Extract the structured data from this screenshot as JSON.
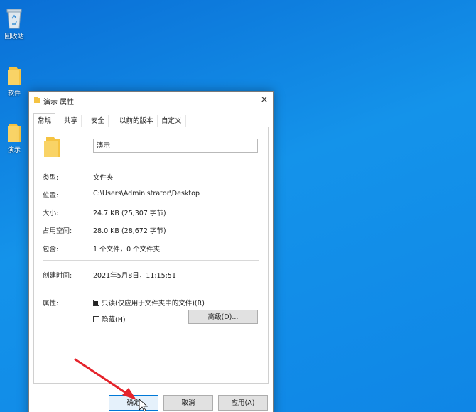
{
  "desktop": {
    "icons": [
      {
        "label": "回收站",
        "icon": "recycle-bin-icon"
      },
      {
        "label": "软件",
        "icon": "folder-icon"
      },
      {
        "label": "演示",
        "icon": "folder-icon"
      }
    ]
  },
  "dialog": {
    "title": "演示 属性",
    "close_glyph": "×",
    "tabs": [
      "常规",
      "共享",
      "安全",
      "以前的版本",
      "自定义"
    ],
    "active_tab": "常规",
    "name_value": "演示",
    "properties": [
      {
        "label": "类型:",
        "value": "文件夹"
      },
      {
        "label": "位置:",
        "value": "C:\\Users\\Administrator\\Desktop"
      },
      {
        "label": "大小:",
        "value": "24.7 KB (25,307 字节)"
      },
      {
        "label": "占用空间:",
        "value": "28.0 KB (28,672 字节)"
      },
      {
        "label": "包含:",
        "value": "1 个文件，0 个文件夹"
      }
    ],
    "created": {
      "label": "创建时间:",
      "value": "2021年5月8日，11:15:51"
    },
    "attributes": {
      "label": "属性:",
      "readonly_label": "只读(仅应用于文件夹中的文件)(R)",
      "readonly_checked": true,
      "hidden_label": "隐藏(H)",
      "hidden_checked": false,
      "advanced_label": "高级(D)..."
    },
    "buttons": {
      "ok": "确定",
      "cancel": "取消",
      "apply": "应用(A)"
    }
  },
  "colors": {
    "desktop_blue": "#1493ea",
    "folder_yellow": "#f5c342",
    "arrow_red": "#e5232b",
    "ok_border": "#0078d7"
  }
}
